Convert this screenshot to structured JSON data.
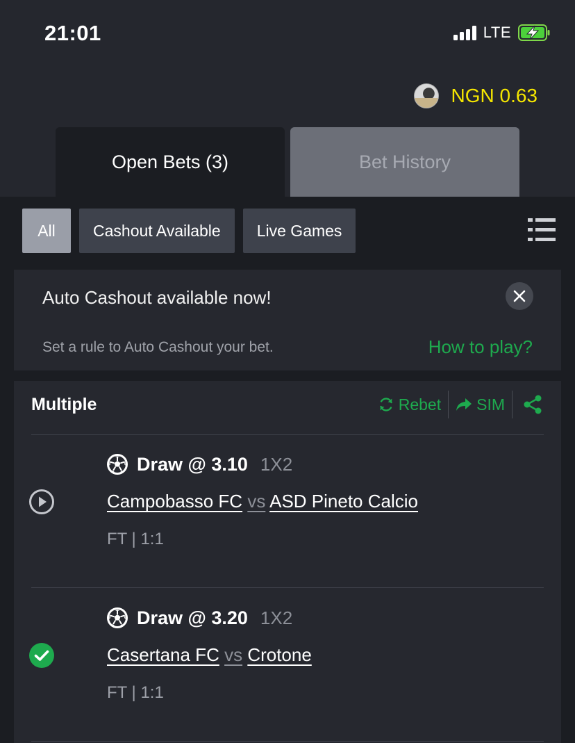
{
  "status_bar": {
    "time": "21:01",
    "network": "LTE"
  },
  "header": {
    "balance": "NGN 0.63"
  },
  "tabs": [
    {
      "label": "Open Bets (3)",
      "active": true
    },
    {
      "label": "Bet History",
      "active": false
    }
  ],
  "filters": [
    {
      "label": "All",
      "active": true
    },
    {
      "label": "Cashout Available",
      "active": false
    },
    {
      "label": "Live Games",
      "active": false
    }
  ],
  "notice": {
    "title": "Auto Cashout available now!",
    "subtitle": "Set a rule to Auto Cashout your bet.",
    "link": "How to play?"
  },
  "bet": {
    "type": "Multiple",
    "actions": {
      "rebet": "Rebet",
      "sim": "SIM"
    },
    "selections": [
      {
        "status_icon": "play-circle-icon",
        "pick": "Draw @ 3.10",
        "market": "1X2",
        "home": "Campobasso FC",
        "vs": "vs",
        "away": "ASD Pineto Calcio",
        "result": "FT | 1:1"
      },
      {
        "status_icon": "check-circle-icon",
        "pick": "Draw @ 3.20",
        "market": "1X2",
        "home": "Casertana FC",
        "vs": "vs",
        "away": "Crotone",
        "result": "FT | 1:1"
      }
    ]
  },
  "colors": {
    "background": "#25272e",
    "panel": "#1b1d22",
    "card": "#26282f",
    "accent_green": "#1eaa4e",
    "balance_yellow": "#f5e600"
  }
}
